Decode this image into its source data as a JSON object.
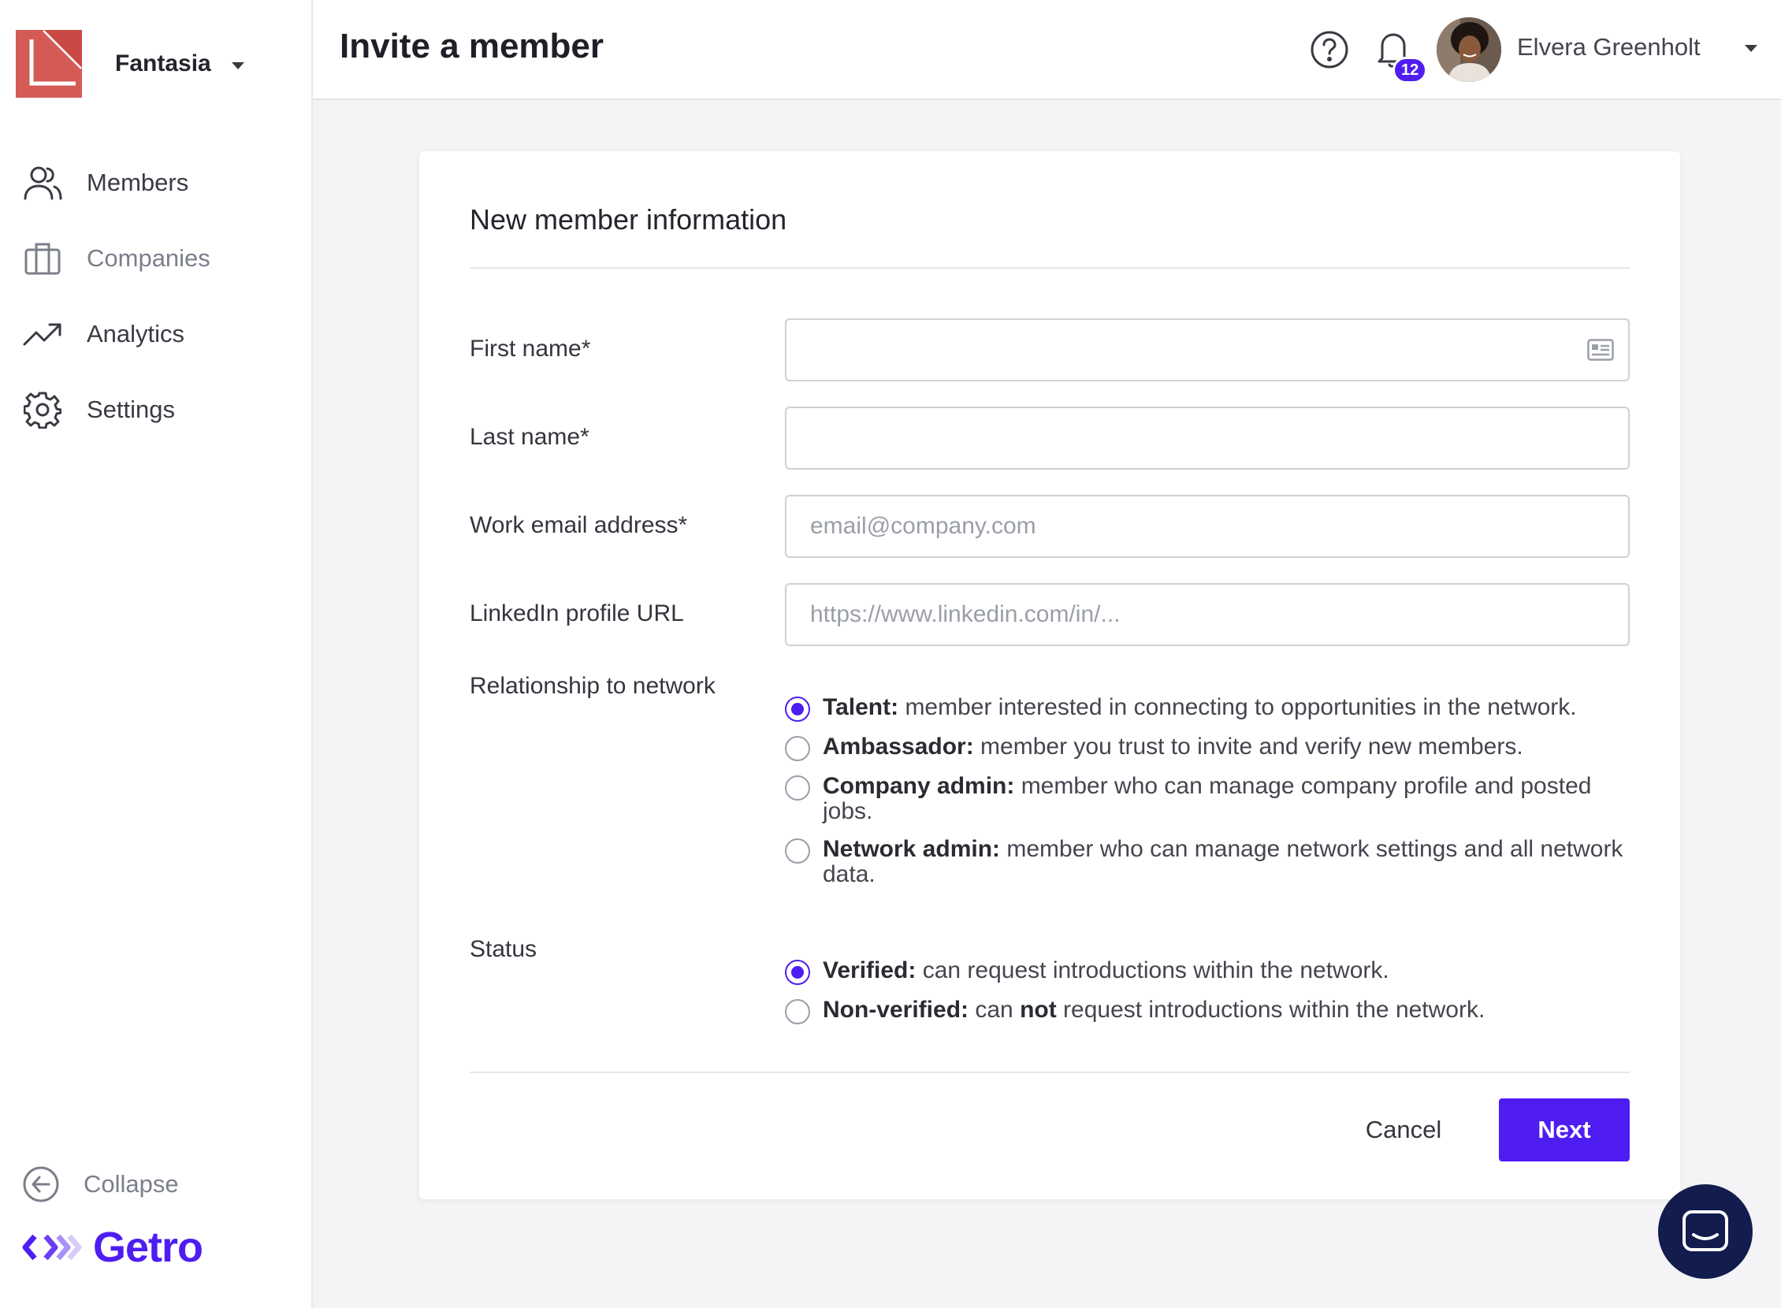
{
  "org": {
    "name": "Fantasia"
  },
  "sidebar": {
    "items": [
      {
        "label": "Members",
        "icon": "users-icon"
      },
      {
        "label": "Companies",
        "icon": "briefcase-icon"
      },
      {
        "label": "Analytics",
        "icon": "trend-up-icon"
      },
      {
        "label": "Settings",
        "icon": "gear-icon"
      }
    ],
    "collapse_label": "Collapse",
    "brand_name": "Getro"
  },
  "header": {
    "title": "Invite a member",
    "notification_count": "12",
    "user_name": "Elvera Greenholt"
  },
  "form": {
    "title": "New member information",
    "first_name": {
      "label": "First name*",
      "value": "",
      "placeholder": ""
    },
    "last_name": {
      "label": "Last name*",
      "value": "",
      "placeholder": ""
    },
    "email": {
      "label": "Work email address*",
      "value": "",
      "placeholder": "email@company.com"
    },
    "linkedin": {
      "label": "LinkedIn profile URL",
      "value": "",
      "placeholder": "https://www.linkedin.com/in/..."
    },
    "relationship": {
      "label": "Relationship to network",
      "options": [
        {
          "name": "Talent:",
          "desc": " member interested in connecting to opportunities in the network.",
          "checked": true
        },
        {
          "name": "Ambassador:",
          "desc": " member you trust to invite and verify new members.",
          "checked": false
        },
        {
          "name": "Company admin:",
          "desc": " member who can manage company profile and posted jobs.",
          "checked": false
        },
        {
          "name": "Network admin:",
          "desc": " member who can manage network settings and all network data.",
          "checked": false
        }
      ]
    },
    "status": {
      "label": "Status",
      "verified": {
        "name": "Verified:",
        "desc": " can request introductions within the network.",
        "checked": true
      },
      "nonverified": {
        "name": "Non-verified:",
        "desc_pre": " can ",
        "desc_bold": "not",
        "desc_post": " request introductions within the network.",
        "checked": false
      }
    },
    "cancel_label": "Cancel",
    "next_label": "Next"
  },
  "colors": {
    "accent": "#4f1df2",
    "logo_red": "#d9534f",
    "chat_bg": "#121d4d"
  }
}
